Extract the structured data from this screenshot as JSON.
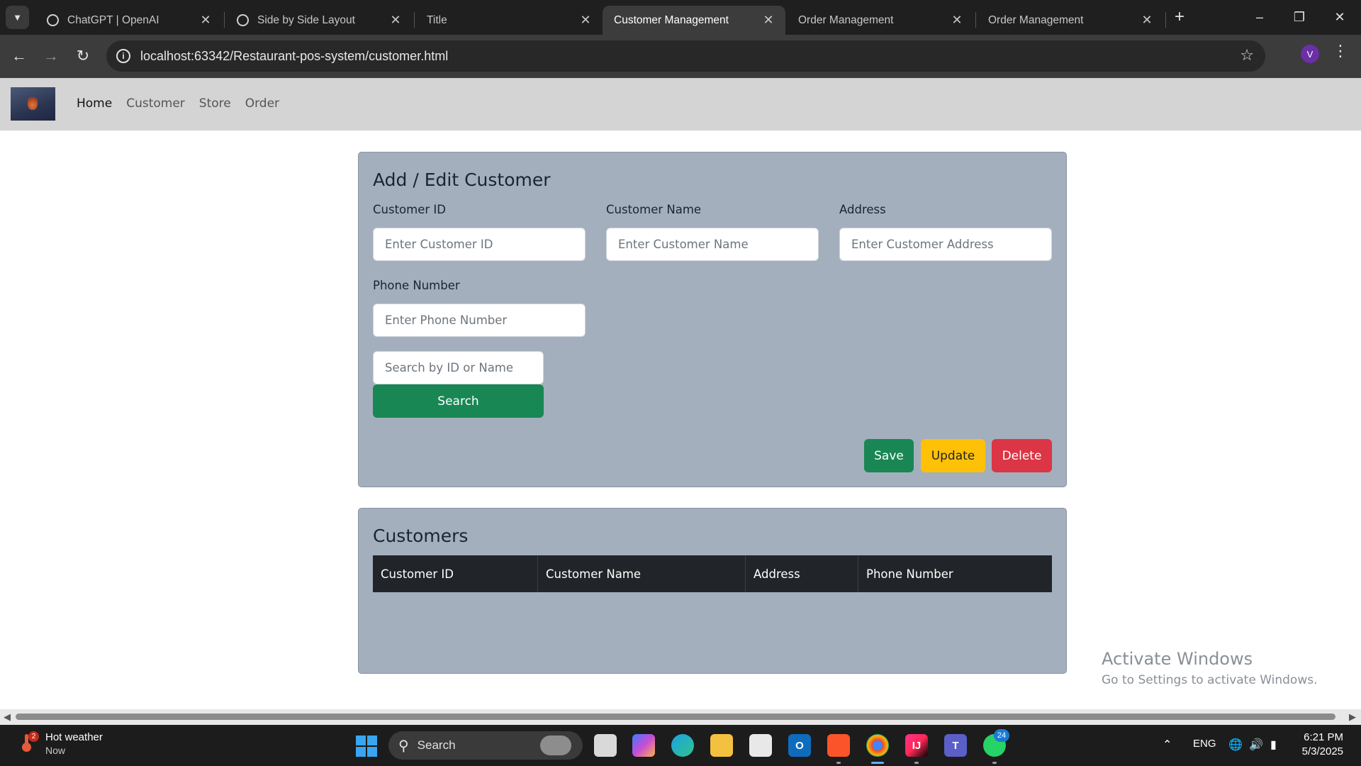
{
  "browser": {
    "tabs": [
      {
        "title": "ChatGPT | OpenAI",
        "favicon": "openai-icon",
        "active": false
      },
      {
        "title": "Side by Side Layout",
        "favicon": "openai-icon",
        "active": false
      },
      {
        "title": "Title",
        "favicon": "page-icon",
        "active": false
      },
      {
        "title": "Customer Management",
        "favicon": "page-icon",
        "active": true
      },
      {
        "title": "Order Management",
        "favicon": "page-icon",
        "active": false
      },
      {
        "title": "Order Management",
        "favicon": "page-icon",
        "active": false
      }
    ],
    "url": "localhost:63342/Restaurant-pos-system/customer.html",
    "profile_initial": "V"
  },
  "navbar": {
    "links": [
      "Home",
      "Customer",
      "Store",
      "Order"
    ],
    "active": "Home"
  },
  "form": {
    "title": "Add / Edit Customer",
    "fields": [
      {
        "label": "Customer ID",
        "placeholder": "Enter Customer ID",
        "value": ""
      },
      {
        "label": "Customer Name",
        "placeholder": "Enter Customer Name",
        "value": ""
      },
      {
        "label": "Address",
        "placeholder": "Enter Customer Address",
        "value": ""
      },
      {
        "label": "Phone Number",
        "placeholder": "Enter Phone Number",
        "value": ""
      }
    ],
    "search_placeholder": "Search by ID or Name",
    "search_button": "Search",
    "save_button": "Save",
    "update_button": "Update",
    "delete_button": "Delete",
    "colors": {
      "success": "#198754",
      "warning": "#ffc107",
      "danger": "#dc3545"
    }
  },
  "table": {
    "title": "Customers",
    "columns": [
      "Customer ID",
      "Customer Name",
      "Address",
      "Phone Number"
    ],
    "rows": []
  },
  "watermark": {
    "line1": "Activate Windows",
    "line2": "Go to Settings to activate Windows."
  },
  "taskbar": {
    "weather_title": "Hot weather",
    "weather_sub": "Now",
    "weather_badge": "2",
    "search_label": "Search",
    "teams_badge": "24",
    "language": "ENG",
    "time": "6:21 PM",
    "date": "5/3/2025"
  }
}
